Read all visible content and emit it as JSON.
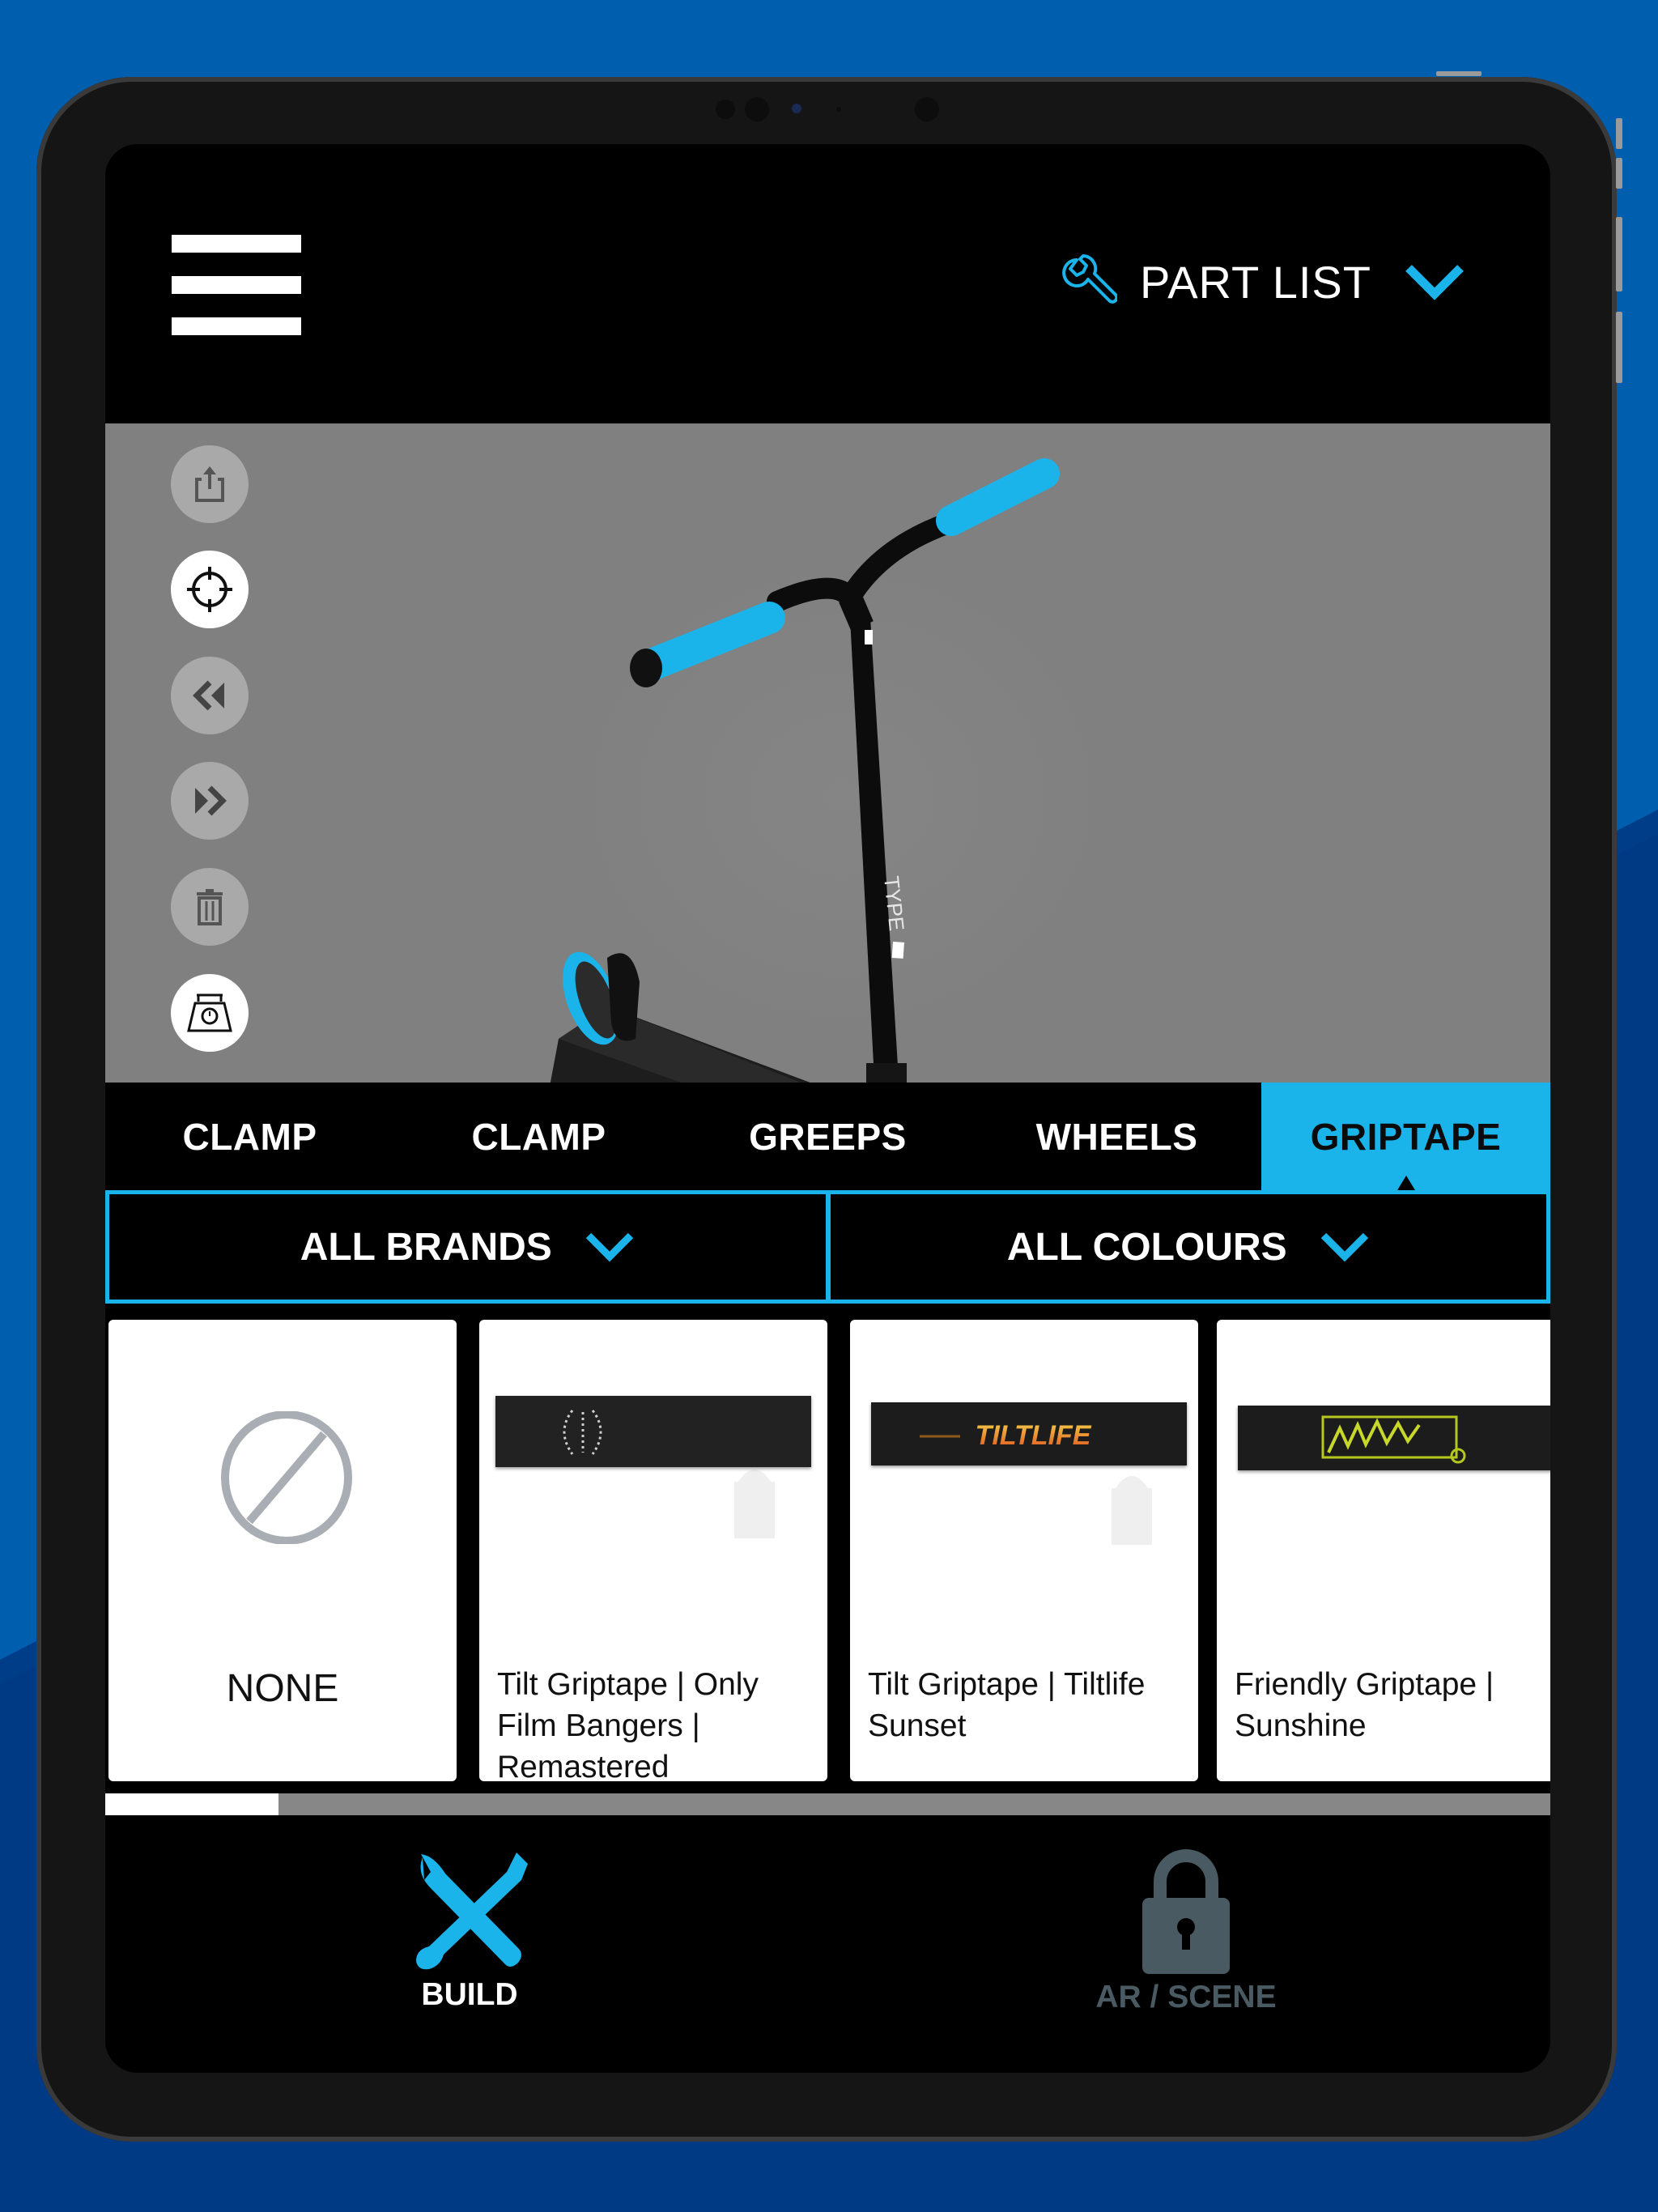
{
  "colors": {
    "page_bg": "#005EAE",
    "page_band": "#003A85",
    "accent": "#1AB4EB",
    "viewport_bg": "#808080",
    "locked": "#4A5A62"
  },
  "header": {
    "menu_icon": "hamburger-menu-icon",
    "part_list_icon": "wrench-icon",
    "part_list_label": "PART LIST",
    "part_list_chevron": "chevron-down-icon"
  },
  "viewport": {
    "tools": [
      {
        "name": "share",
        "icon": "share-icon",
        "state": "dim"
      },
      {
        "name": "recenter",
        "icon": "crosshair-icon",
        "state": "active"
      },
      {
        "name": "previous",
        "icon": "rewind-icon",
        "state": "dim"
      },
      {
        "name": "next",
        "icon": "fast-forward-icon",
        "state": "dim"
      },
      {
        "name": "delete",
        "icon": "trash-icon",
        "state": "dim"
      },
      {
        "name": "weight",
        "icon": "scale-icon",
        "state": "active"
      }
    ],
    "model": "scooter-3d-preview"
  },
  "tabs": [
    {
      "label": "CLAMP",
      "active": false
    },
    {
      "label": "CLAMP",
      "active": false
    },
    {
      "label": "GREEPS",
      "active": false
    },
    {
      "label": "WHEELS",
      "active": false
    },
    {
      "label": "GRIPTAPE",
      "active": true
    }
  ],
  "filters": {
    "brands": {
      "label": "ALL BRANDS"
    },
    "colours": {
      "label": "ALL COLOURS"
    }
  },
  "cards": [
    {
      "name": "NONE",
      "thumb": "none-icon"
    },
    {
      "name": "Tilt Griptape | Only Film Bangers | Remastered",
      "thumb": "griptape-only-film-bangers"
    },
    {
      "name": "Tilt Griptape | Tiltlife Sunset",
      "thumb": "griptape-tiltlife-sunset",
      "thumb_text": "TILTLIFE"
    },
    {
      "name": "Friendly Griptape | Sunshine",
      "thumb": "griptape-friendly-sunshine"
    }
  ],
  "scroll": {
    "position_fraction": 0.12
  },
  "bottom_nav": {
    "build": {
      "label": "BUILD",
      "icon": "tools-icon",
      "active": true
    },
    "ar_scene": {
      "label": "AR / SCENE",
      "icon": "lock-icon",
      "locked": true
    }
  }
}
